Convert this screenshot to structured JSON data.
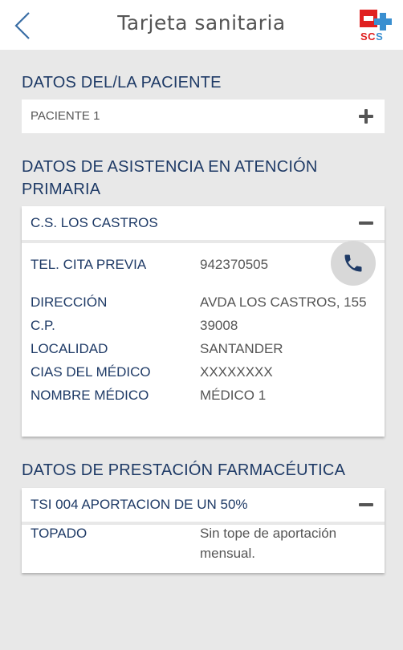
{
  "header": {
    "title": "Tarjeta sanitaria",
    "logo_text_main": "SC",
    "logo_text_accent": "S"
  },
  "colors": {
    "accent_navy": "#1e3a66",
    "logo_red": "#e02020",
    "logo_blue": "#3a8fd0",
    "background": "#e8e8e8"
  },
  "patient_section": {
    "title": "DATOS DEL/LA PACIENTE",
    "patient_label": "PACIENTE 1",
    "expand_icon": "plus-icon"
  },
  "primary_care": {
    "title": "DATOS DE ASISTENCIA EN ATENCIÓN PRIMARIA",
    "center_name": "C.S. LOS CASTROS",
    "collapse_icon": "minus-icon",
    "fields": [
      {
        "label": "TEL. CITA PREVIA",
        "value": "942370505"
      },
      {
        "label": "DIRECCIÓN",
        "value": "AVDA LOS CASTROS, 155"
      },
      {
        "label": "C.P.",
        "value": "39008"
      },
      {
        "label": "LOCALIDAD",
        "value": "SANTANDER"
      },
      {
        "label": "CIAS DEL MÉDICO",
        "value": "XXXXXXXX"
      },
      {
        "label": "NOMBRE MÉDICO",
        "value": "MÉDICO 1"
      }
    ],
    "call_icon": "phone-icon"
  },
  "pharmacy": {
    "title": "DATOS DE PRESTACIÓN FARMACÉUTICA",
    "plan_label": "TSI 004 APORTACION DE UN 50%",
    "collapse_icon": "minus-icon",
    "cap_label": "TOPADO",
    "cap_value_line1": "Sin tope de aportación",
    "cap_value_line2": "mensual."
  }
}
